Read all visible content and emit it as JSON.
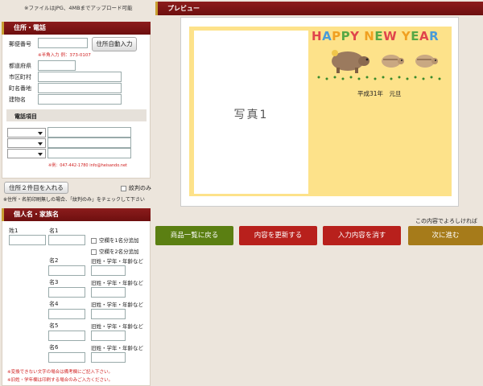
{
  "upload_note": "※ファイルはJPG、4MBまでアップロード可能",
  "preview": {
    "header": "プレビュー",
    "photo_label": "写真1",
    "happy": "HAPPY NEW YEAR",
    "date_text": "平成31年　元旦"
  },
  "address": {
    "header": "住所・電話",
    "postal_label": "郵便番号",
    "auto_button": "住所自動入力",
    "postal_note": "※半角入力 例：373-0107",
    "pref_label": "都道府県",
    "city_label": "市区町村",
    "town_label": "町名番地",
    "bldg_label": "建物名",
    "phone_section": "電話項目",
    "phone_example": "※例：047-442-1780 info@heisando.net",
    "add_second_button": "住所２件目を入れる",
    "crest_only": "紋判のみ",
    "print_note": "※住所・名前印刷無しの場合、「紋判のみ」をチェックして下さい"
  },
  "names": {
    "header": "個人名・家族名",
    "sei_label": "姓1",
    "mei_label": "名1",
    "blank1": "空欄を1名分追加",
    "blank2": "空欄を2名分追加",
    "old_name_label": "旧姓・学年・年齢など",
    "rows": [
      "名2",
      "名3",
      "名4",
      "名5",
      "名6"
    ],
    "note1": "※変換できない文字の場合は備考欄にご記入下さい。",
    "note2": "※旧姓・学年欄は印刷する場合のみご入力ください。"
  },
  "actions": {
    "confirm_note": "この内容でよろしければ",
    "back": "商品一覧に戻る",
    "update": "内容を更新する",
    "clear": "入力内容を消す",
    "next": "次に進む"
  },
  "colors": {
    "header": "#7a1515",
    "green": "#5b7f12",
    "red": "#b8201c",
    "gold": "#a67b1a",
    "card_bg": "#fde28a"
  }
}
